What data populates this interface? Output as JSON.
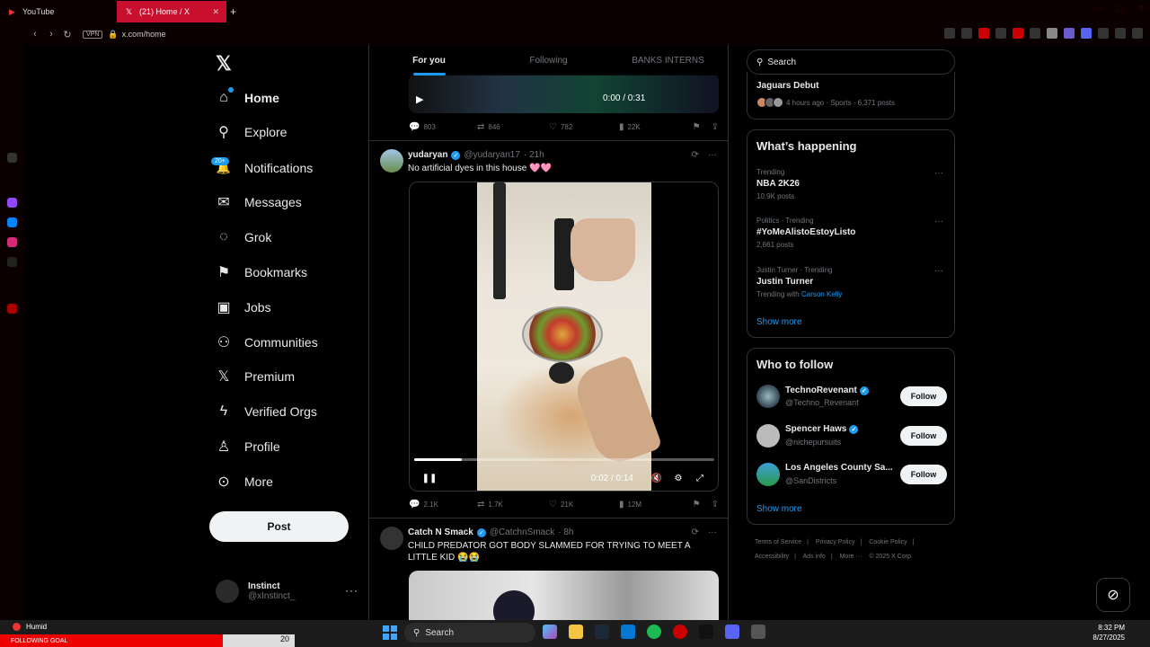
{
  "browser": {
    "tabs": [
      {
        "label": "YouTube",
        "icon": "youtube-icon",
        "active": false
      },
      {
        "label": "(21) Home / X",
        "icon": "x-icon",
        "active": true
      }
    ],
    "new_tab_label": "+",
    "vpn_label": "VPN",
    "url": "x.com/home",
    "accent": "#c8102e"
  },
  "nav": {
    "items": [
      {
        "label": "Home",
        "icon": "home-icon",
        "glyph": "⌂"
      },
      {
        "label": "Explore",
        "icon": "search-icon",
        "glyph": "⚲"
      },
      {
        "label": "Notifications",
        "icon": "bell-icon",
        "glyph": "🔔"
      },
      {
        "label": "Messages",
        "icon": "envelope-icon",
        "glyph": "✉"
      },
      {
        "label": "Grok",
        "icon": "grok-icon",
        "glyph": "◌"
      },
      {
        "label": "Bookmarks",
        "icon": "bookmark-icon",
        "glyph": "⚑"
      },
      {
        "label": "Jobs",
        "icon": "briefcase-icon",
        "glyph": "▣"
      },
      {
        "label": "Communities",
        "icon": "people-icon",
        "glyph": "⚇"
      },
      {
        "label": "Premium",
        "icon": "x-icon",
        "glyph": "𝕏"
      },
      {
        "label": "Verified Orgs",
        "icon": "lightning-icon",
        "glyph": "ϟ"
      },
      {
        "label": "Profile",
        "icon": "person-icon",
        "glyph": "♙"
      },
      {
        "label": "More",
        "icon": "more-circle-icon",
        "glyph": "⊙"
      }
    ],
    "notifications_badge": "20+",
    "post_label": "Post",
    "account": {
      "name": "Instinct",
      "handle": "@xInstinct_",
      "more": "···"
    }
  },
  "timeline": {
    "tabs": [
      "For you",
      "Following",
      "BANKS INTERNS"
    ],
    "prev_tweet": {
      "video_time": "0:00 / 0:31",
      "actions": {
        "replies": "803",
        "reposts": "846",
        "likes": "782",
        "views": "22K"
      }
    },
    "tweet1": {
      "name": "yudaryan",
      "handle": "@yudaryan17",
      "time": "· 21h",
      "text": "No artificial dyes in this house 🩷🩷",
      "video_time": "0:02 / 0:14",
      "video_progress": 0.16,
      "actions": {
        "replies": "2.1K",
        "reposts": "1.7K",
        "likes": "21K",
        "views": "12M"
      }
    },
    "tweet2": {
      "name": "Catch N Smack",
      "handle": "@CatchnSmack",
      "time": "· 8h",
      "text": "CHILD PREDATOR GOT BODY SLAMMED FOR TRYING TO MEET A LITTLE KID 😭😭"
    }
  },
  "right": {
    "search_placeholder": "Search",
    "top_trend": {
      "title": "Jaguars Debut",
      "meta": "4 hours ago · Sports · 6,371 posts"
    },
    "whats_happening": {
      "heading": "What’s happening",
      "trends": [
        {
          "category": "Trending",
          "name": "NBA 2K26",
          "posts": "10.9K posts",
          "with": ""
        },
        {
          "category": "Politics · Trending",
          "name": "#YoMeAlistoEstoyListo",
          "posts": "2,661 posts",
          "with": ""
        },
        {
          "category": "Justin Turner · Trending",
          "name": "Justin Turner",
          "posts": "Trending with",
          "with": "Carson Kelly"
        }
      ],
      "show_more": "Show more"
    },
    "who_to_follow": {
      "heading": "Who to follow",
      "users": [
        {
          "name": "TechnoRevenant",
          "handle": "@Techno_Revenant",
          "button": "Follow",
          "verified": true
        },
        {
          "name": "Spencer Haws",
          "handle": "@nichepursuits",
          "button": "Follow",
          "verified": true
        },
        {
          "name": "Los Angeles County Sa...",
          "handle": "@SanDistricts",
          "button": "Follow",
          "verified": false
        }
      ],
      "show_more": "Show more"
    },
    "footer": [
      "Terms of Service",
      "|",
      "Privacy Policy",
      "|",
      "Cookie Policy",
      "|",
      "Accessibility",
      "|",
      "Ads info",
      "|",
      "More ···",
      "© 2025 X Corp."
    ]
  },
  "taskbar": {
    "weather": "Humid",
    "ticker": "FOLLOWING GOAL",
    "ticker_count": "20",
    "search": "Search",
    "time": "8:32 PM",
    "date": "8/27/2025"
  }
}
